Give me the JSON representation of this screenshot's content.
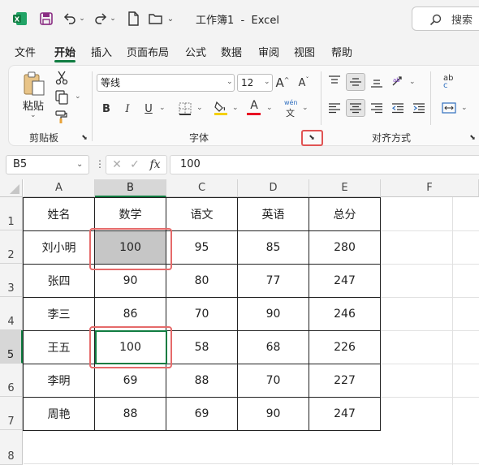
{
  "title_bar": {
    "title": "工作簿1  -  Excel",
    "search_label": "搜索"
  },
  "tabs": [
    "文件",
    "开始",
    "插入",
    "页面布局",
    "公式",
    "数据",
    "审阅",
    "视图",
    "帮助"
  ],
  "active_tab": "开始",
  "ribbon": {
    "clipboard": {
      "paste_label": "粘贴",
      "group_label": "剪贴板"
    },
    "font": {
      "font_name": "等线",
      "font_size": "12",
      "bold": "B",
      "italic": "I",
      "underline": "U",
      "grow_font": "A",
      "shrink_font": "A",
      "font_color_letter": "A",
      "phonetic_top": "wén",
      "phonetic_bottom": "文",
      "group_label": "字体",
      "highlight_color": "#f4d000",
      "font_color": "#e81123"
    },
    "alignment": {
      "group_label": "对齐方式",
      "wrap_top": "ab",
      "wrap_bottom": "c"
    }
  },
  "formula_bar": {
    "name_box": "B5",
    "formula": "100",
    "fx_label": "fx"
  },
  "columns": [
    "A",
    "B",
    "C",
    "D",
    "E",
    "F"
  ],
  "rows": [
    "1",
    "2",
    "3",
    "4",
    "5",
    "6",
    "7",
    "8"
  ],
  "table": {
    "headers": [
      "姓名",
      "数学",
      "语文",
      "英语",
      "总分"
    ],
    "rows": [
      [
        "刘小明",
        "100",
        "95",
        "85",
        "280"
      ],
      [
        "张四",
        "90",
        "80",
        "77",
        "247"
      ],
      [
        "李三",
        "86",
        "70",
        "90",
        "246"
      ],
      [
        "王五",
        "100",
        "58",
        "68",
        "226"
      ],
      [
        "李明",
        "69",
        "88",
        "70",
        "227"
      ],
      [
        "周艳",
        "88",
        "69",
        "90",
        "247"
      ]
    ]
  },
  "colors": {
    "accent_green": "#107c41",
    "annotation_red": "#e05353",
    "gray_fill": "#c6c6c6"
  }
}
